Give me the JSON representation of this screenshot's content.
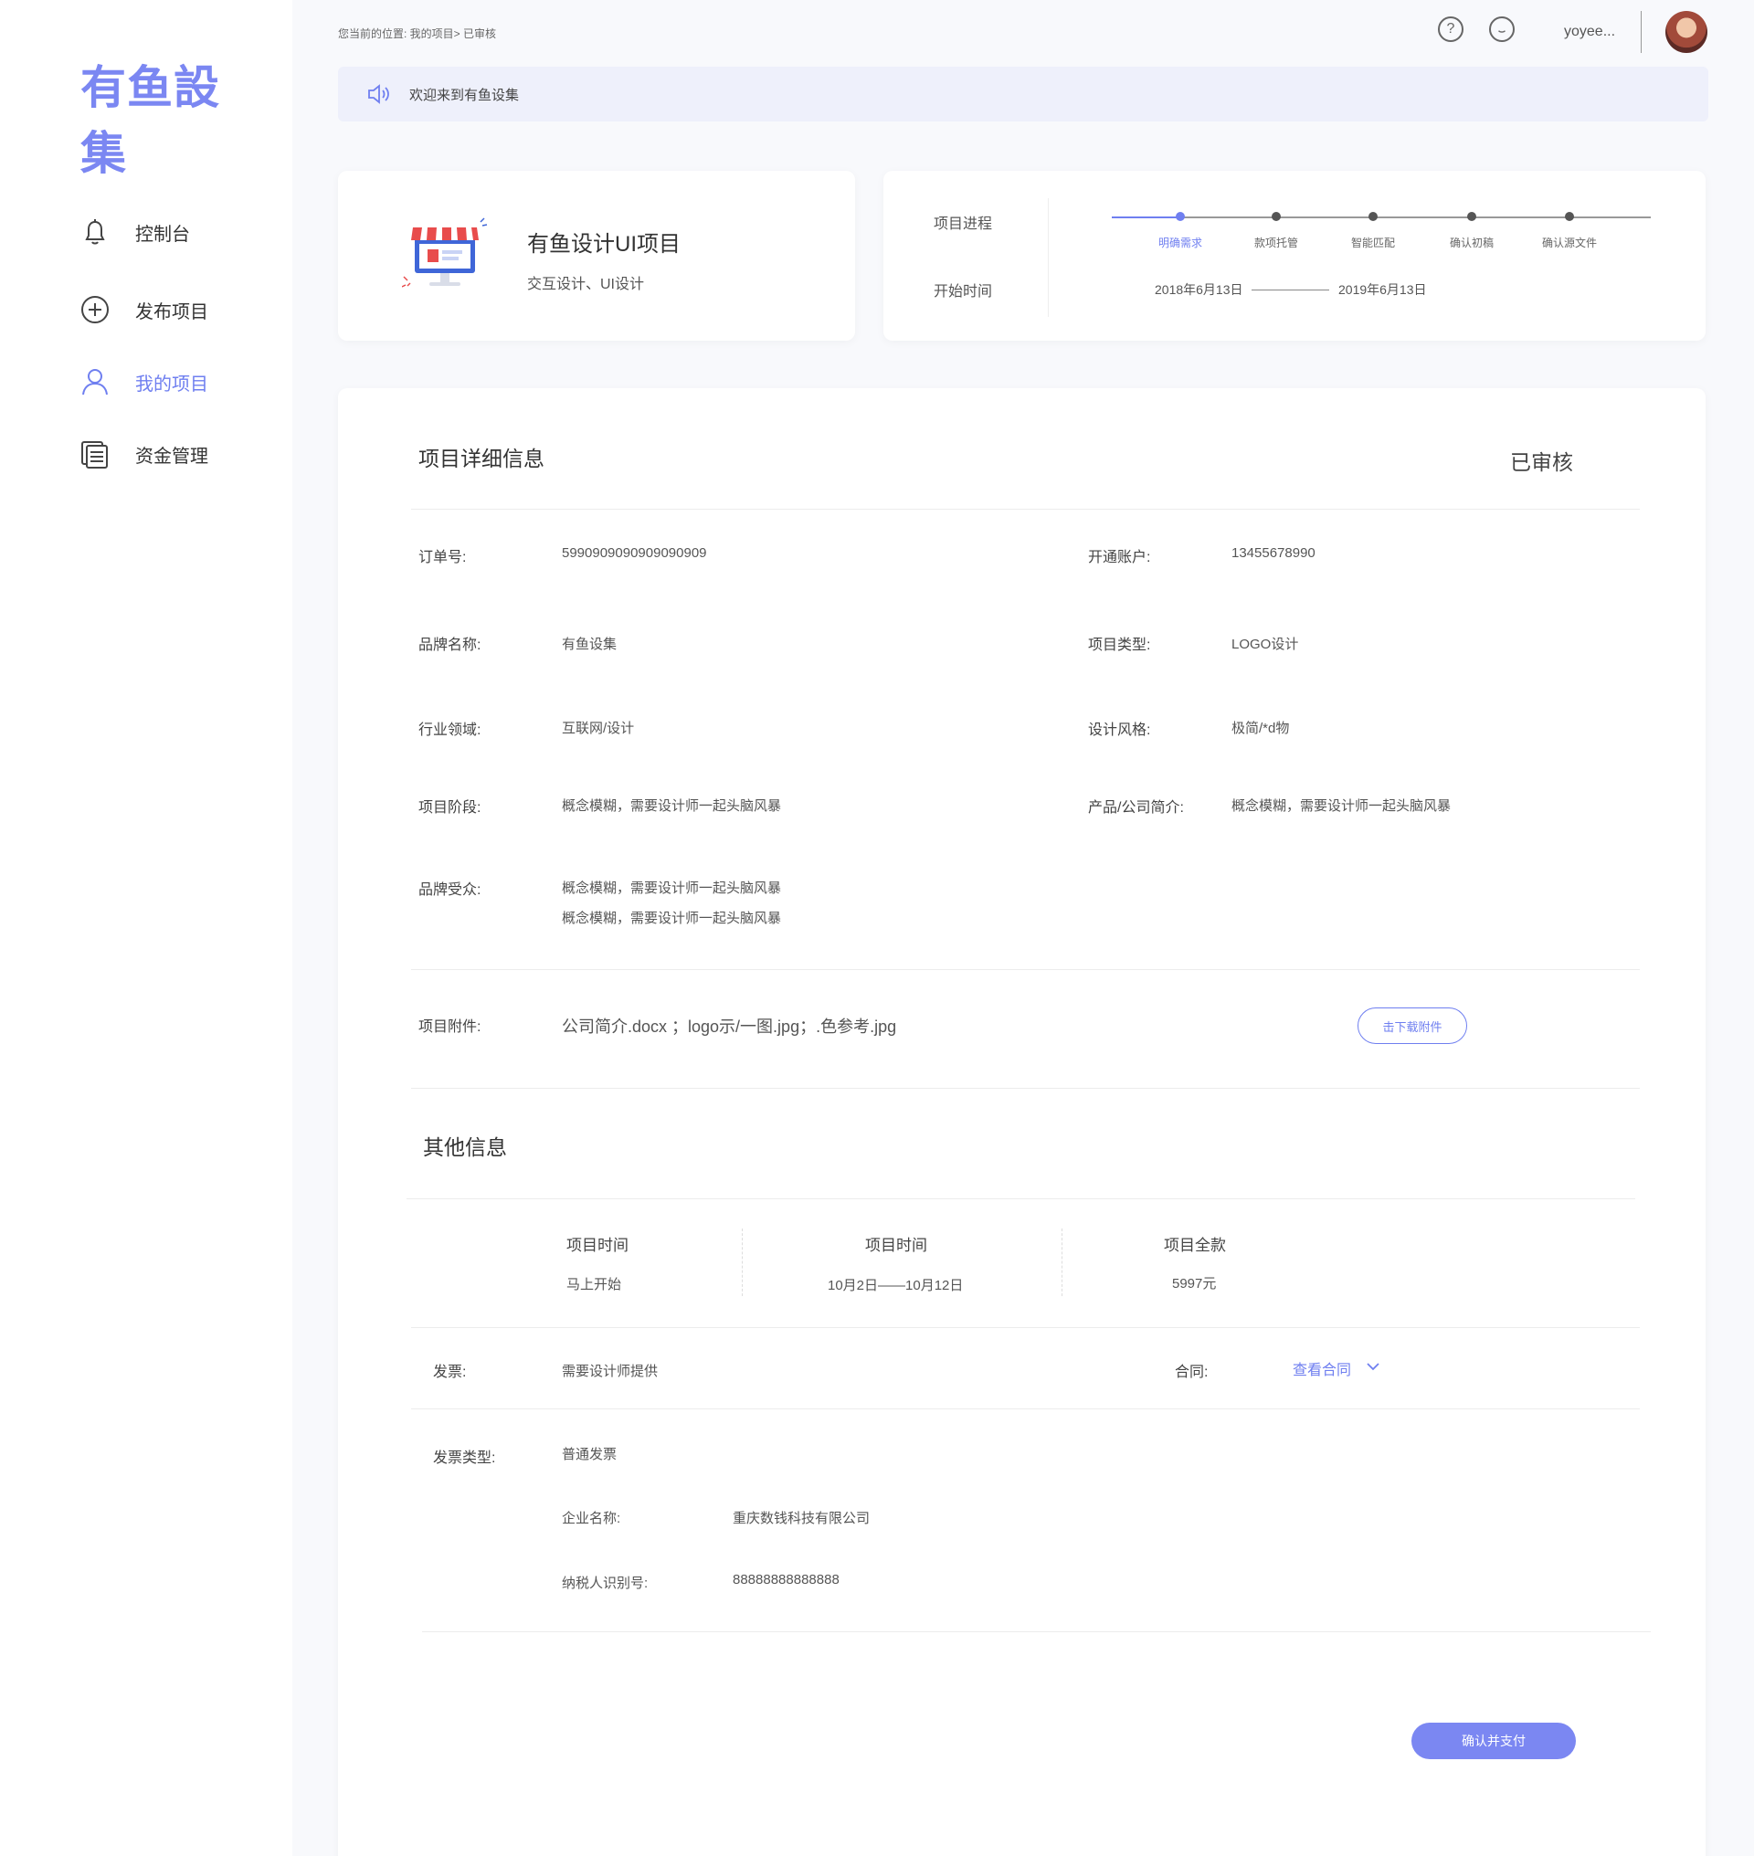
{
  "brand": {
    "logo_text": "有鱼設集"
  },
  "sidebar": {
    "items": [
      {
        "label": "控制台",
        "icon": "bell-icon"
      },
      {
        "label": "发布项目",
        "icon": "plus-circle-icon"
      },
      {
        "label": "我的项目",
        "icon": "user-icon",
        "active": true
      },
      {
        "label": "资金管理",
        "icon": "documents-icon"
      }
    ]
  },
  "header": {
    "breadcrumb": "您当前的位置:  我的项目> 已审核",
    "username": "yoyee...",
    "help_icon": "help-icon",
    "message_icon": "chat-icon"
  },
  "notice": {
    "text": "欢迎来到有鱼设集",
    "icon": "speaker-icon"
  },
  "project_card": {
    "title": "有鱼设计UI项目",
    "subtitle": "交互设计、UI设计",
    "icon": "shop-monitor-icon"
  },
  "progress": {
    "progress_label": "项目进程",
    "start_label": "开始时间",
    "steps": [
      "明确需求",
      "款项托管",
      "智能匹配",
      "确认初稿",
      "确认源文件"
    ],
    "current_step": 0,
    "start_date": "2018年6月13日",
    "end_date": "2019年6月13日",
    "accent": "#6f7ff0"
  },
  "detail": {
    "title": "项目详细信息",
    "status": "已审核",
    "order_label": "订单号:",
    "order_value": "5990909090909090909",
    "account_label": "开通账户:",
    "account_value": "13455678990",
    "brand_label": "品牌名称:",
    "brand_value": "有鱼设集",
    "type_label": "项目类型:",
    "type_value": "LOGO设计",
    "industry_label": "行业领域:",
    "industry_value": "互联网/设计",
    "style_label": "设计风格:",
    "style_value": "极简/*d物",
    "stage_label": "项目阶段:",
    "stage_value": "概念模糊，需要设计师一起头脑风暴",
    "intro_label": "产品/公司简介:",
    "intro_value": "概念模糊，需要设计师一起头脑风暴",
    "audience_label": "品牌受众:",
    "audience_value_1": "概念模糊，需要设计师一起头脑风暴",
    "audience_value_2": "概念模糊，需要设计师一起头脑风暴",
    "attach_label": "项目附件:",
    "attach_value": "公司简介.docx ；logo示/一图.jpg；.色参考.jpg",
    "download_button": "击下载附件"
  },
  "other": {
    "title": "其他信息",
    "stats": [
      {
        "label": "项目时间",
        "value": "马上开始"
      },
      {
        "label": "项目时间",
        "value": "10月2日——10月12日"
      },
      {
        "label": "项目全款",
        "value": "5997元"
      }
    ],
    "invoice_label": "发票:",
    "invoice_value": "需要设计师提供",
    "contract_label": "合同:",
    "contract_link": "查看合同",
    "invoice_type_label": "发票类型:",
    "invoice_type_value": "普通发票",
    "company_label": "企业名称:",
    "company_value": "重庆数钱科技有限公司",
    "tax_label": "纳税人识别号:",
    "tax_value": "88888888888888",
    "confirm_button": "确认并支付"
  }
}
